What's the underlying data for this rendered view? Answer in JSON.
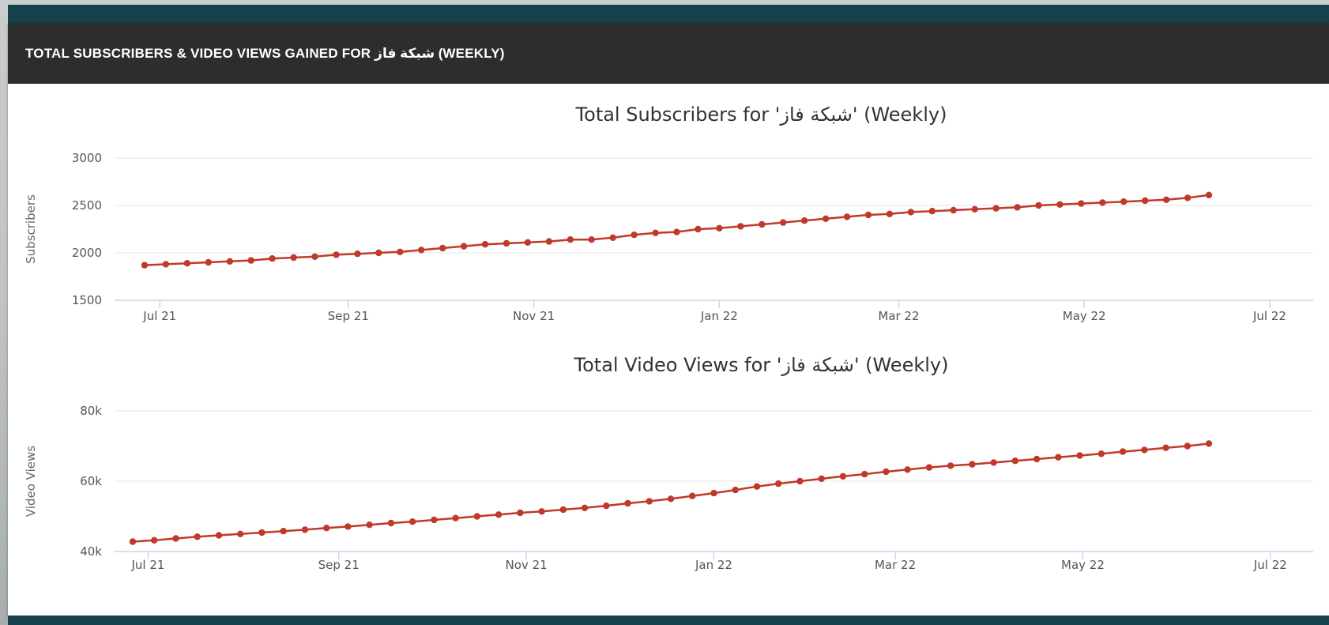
{
  "header": {
    "title": "TOTAL SUBSCRIBERS & VIDEO VIEWS GAINED FOR شبكة فاز (WEEKLY)"
  },
  "colors": {
    "line": "#c0392b",
    "grid": "#e6e6e6",
    "axis": "#ccd6eb",
    "header_bg": "#2d2d2d",
    "accent_bar": "#16414a"
  },
  "chart_data": [
    {
      "type": "line",
      "title": "Total Subscribers for 'شبكة فاز' (Weekly)",
      "xlabel": "",
      "ylabel": "Subscribers",
      "x_start": "2021-06-26",
      "x_interval_days": 7,
      "x_ticks": [
        {
          "label": "Jul 21",
          "date": "2021-07-01"
        },
        {
          "label": "Sep 21",
          "date": "2021-09-01"
        },
        {
          "label": "Nov 21",
          "date": "2021-11-01"
        },
        {
          "label": "Jan 22",
          "date": "2022-01-01"
        },
        {
          "label": "Mar 22",
          "date": "2022-03-01"
        },
        {
          "label": "May 22",
          "date": "2022-05-01"
        },
        {
          "label": "Jul 22",
          "date": "2022-07-01"
        }
      ],
      "y_ticks": [
        {
          "value": 1500,
          "label": "1500"
        },
        {
          "value": 2000,
          "label": "2000"
        },
        {
          "value": 2500,
          "label": "2500"
        },
        {
          "value": 3000,
          "label": "3000"
        }
      ],
      "ylim": [
        1500,
        3000
      ],
      "grid": true,
      "series": [
        {
          "values": [
            1870,
            1880,
            1890,
            1900,
            1910,
            1920,
            1940,
            1950,
            1960,
            1980,
            1990,
            2000,
            2010,
            2030,
            2050,
            2070,
            2090,
            2100,
            2110,
            2120,
            2140,
            2140,
            2160,
            2190,
            2210,
            2220,
            2250,
            2260,
            2280,
            2300,
            2320,
            2340,
            2360,
            2380,
            2400,
            2410,
            2430,
            2440,
            2450,
            2460,
            2470,
            2480,
            2500,
            2510,
            2520,
            2530,
            2540,
            2550,
            2560,
            2580,
            2610
          ]
        }
      ]
    },
    {
      "type": "line",
      "title": "Total Video Views for 'شبكة فاز' (Weekly)",
      "xlabel": "",
      "ylabel": "Video Views",
      "x_start": "2021-06-26",
      "x_interval_days": 7,
      "x_ticks": [
        {
          "label": "Jul 21",
          "date": "2021-07-01"
        },
        {
          "label": "Sep 21",
          "date": "2021-09-01"
        },
        {
          "label": "Nov 21",
          "date": "2021-11-01"
        },
        {
          "label": "Jan 22",
          "date": "2022-01-01"
        },
        {
          "label": "Mar 22",
          "date": "2022-03-01"
        },
        {
          "label": "May 22",
          "date": "2022-05-01"
        },
        {
          "label": "Jul 22",
          "date": "2022-07-01"
        }
      ],
      "y_ticks": [
        {
          "value": 40000,
          "label": "40k"
        },
        {
          "value": 60000,
          "label": "60k"
        },
        {
          "value": 80000,
          "label": "80k"
        }
      ],
      "ylim": [
        40000,
        80000
      ],
      "grid": true,
      "series": [
        {
          "values": [
            42800,
            43200,
            43700,
            44200,
            44600,
            45000,
            45400,
            45800,
            46200,
            46700,
            47100,
            47600,
            48100,
            48500,
            49000,
            49500,
            50000,
            50500,
            51000,
            51400,
            51900,
            52400,
            53000,
            53700,
            54300,
            55000,
            55800,
            56600,
            57500,
            58500,
            59300,
            60000,
            60700,
            61400,
            62000,
            62700,
            63300,
            63900,
            64400,
            64800,
            65300,
            65800,
            66300,
            66800,
            67300,
            67800,
            68400,
            68900,
            69500,
            70000,
            70700
          ]
        }
      ]
    }
  ]
}
